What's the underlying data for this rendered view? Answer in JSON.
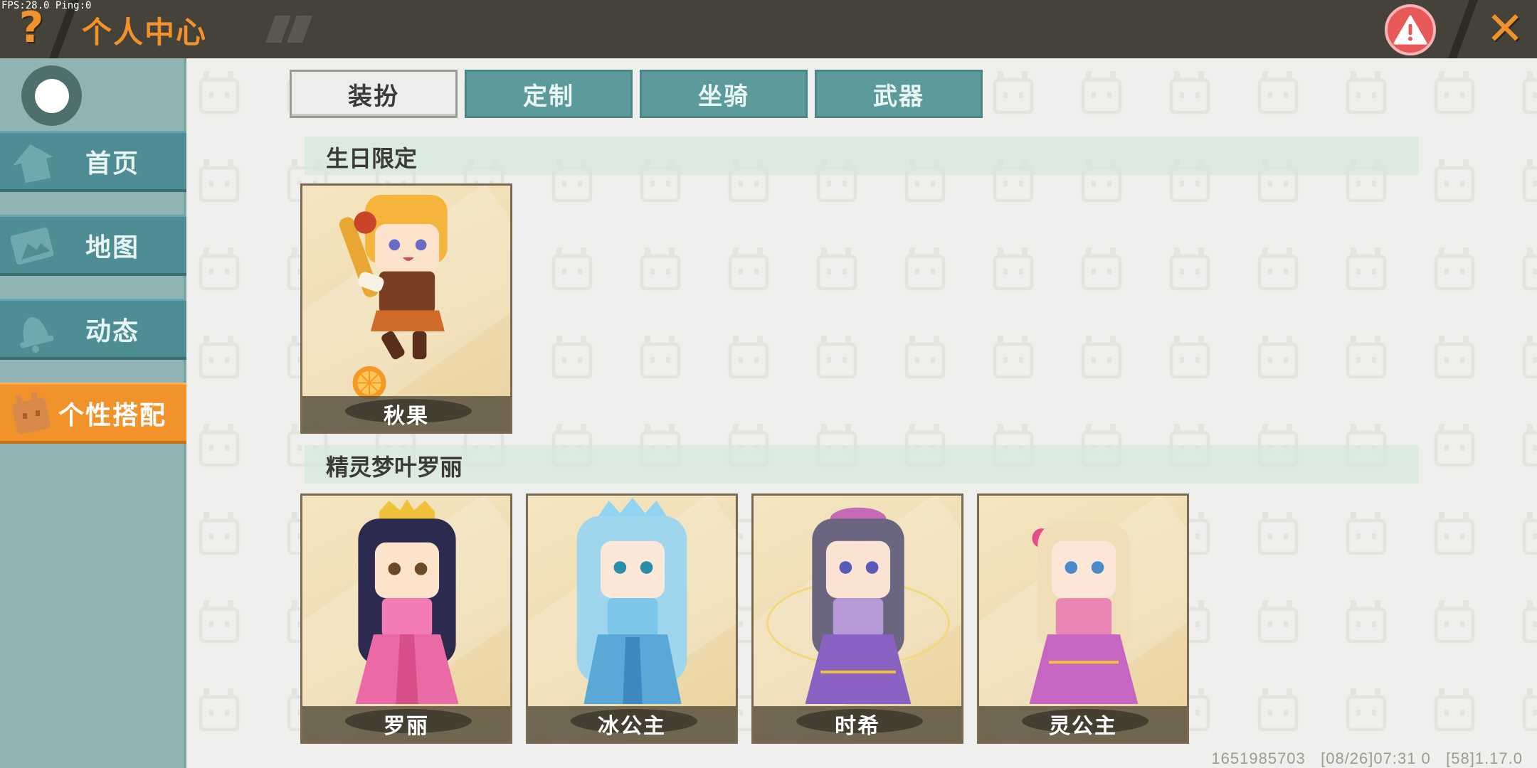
{
  "debug": {
    "fps_text": "FPS:28.0  Ping:0"
  },
  "header": {
    "help_glyph": "?",
    "title": "个人中心",
    "close_glyph": "✕"
  },
  "sidebar": {
    "items": [
      {
        "label": "首页",
        "icon": "home-icon",
        "active": false
      },
      {
        "label": "地图",
        "icon": "map-icon",
        "active": false
      },
      {
        "label": "动态",
        "icon": "bell-icon",
        "active": false
      },
      {
        "label": "个性搭配",
        "icon": "character-icon",
        "active": true
      }
    ]
  },
  "tabs": [
    {
      "label": "装扮",
      "active": true
    },
    {
      "label": "定制",
      "active": false
    },
    {
      "label": "坐骑",
      "active": false
    },
    {
      "label": "武器",
      "active": false
    }
  ],
  "sections": [
    {
      "title": "生日限定",
      "items": [
        {
          "name": "秋果",
          "hair": "#f5b53c",
          "outfit": "#7a3e22"
        }
      ]
    },
    {
      "title": "精灵梦叶罗丽",
      "items": [
        {
          "name": "罗丽",
          "hair": "#2c2a4e",
          "outfit": "#e96aa4"
        },
        {
          "name": "冰公主",
          "hair": "#9fd6ee",
          "outfit": "#5aa8d8"
        },
        {
          "name": "时希",
          "hair": "#6b6680",
          "outfit": "#8a62c4"
        },
        {
          "name": "灵公主",
          "hair": "#f1ddb8",
          "outfit": "#c766c2"
        }
      ]
    }
  ],
  "footer": {
    "info": "1651985703   [08/26]07:31 0   [58]1.17.0"
  },
  "colors": {
    "accent": "#f2922a",
    "teal": "#5c9a9c",
    "sidebar": "#8fb4b3",
    "header": "#444239",
    "warning": "#e85858"
  }
}
